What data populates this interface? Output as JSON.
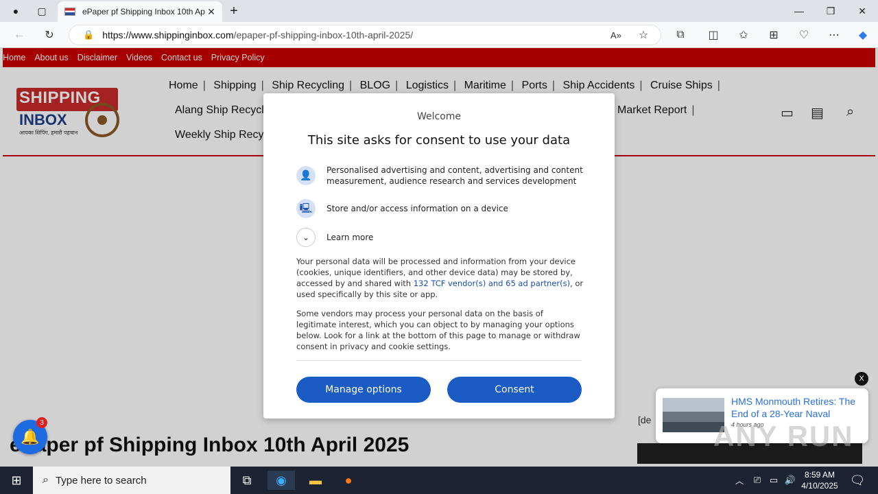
{
  "browser": {
    "tab_title": "ePaper pf Shipping Inbox 10th Ap",
    "url_host": "https://www.shippinginbox.com",
    "url_path": "/epaper-pf-shipping-inbox-10th-april-2025/"
  },
  "site": {
    "top_links": [
      "Home",
      "About us",
      "Disclaimer",
      "Videos",
      "Contact us",
      "Privacy Policy"
    ],
    "logo": {
      "name": "SHIPPING",
      "url_small": "www.shippinginbox.com",
      "inbox": "INBOX",
      "tagline": "आपका शिपिंग, हमारी पहचान"
    },
    "menu_row1": [
      "Home",
      "Shipping",
      "Ship Recycling",
      "BLOG",
      "Logistics",
      "Maritime",
      "Ports",
      "Ship Accidents",
      "Cruise Ships"
    ],
    "menu_row2_left": "Alang Ship Recycli",
    "menu_row2_right": "Market Report",
    "menu_row3_left": "Weekly Ship Recyc",
    "page_title": "ePaper pf Shipping Inbox 10th April 2025",
    "side_text": "[de"
  },
  "consent": {
    "welcome": "Welcome",
    "heading": "This site asks for consent to use your data",
    "purpose1": "Personalised advertising and content, advertising and content measurement, audience research and services development",
    "purpose2": "Store and/or access information on a device",
    "learn_more": "Learn more",
    "para1_a": "Your personal data will be processed and information from your device (cookies, unique identifiers, and other device data) may be stored by, accessed by and shared with ",
    "para1_link": "132 TCF vendor(s) and 65 ad partner(s)",
    "para1_b": ", or used specifically by this site or app.",
    "para2": "Some vendors may process your personal data on the basis of legitimate interest, which you can object to by managing your options below. Look for a link at the bottom of this page to manage or withdraw consent in privacy and cookie settings.",
    "manage_label": "Manage options",
    "consent_label": "Consent"
  },
  "notification": {
    "badge": "3"
  },
  "news_popup": {
    "headline": "HMS Monmouth Retires: The End of a 28-Year Naval",
    "time": "4 hours ago",
    "close": "X"
  },
  "watermark": "ANY RUN",
  "taskbar": {
    "search_placeholder": "Type here to search",
    "time": "8:59 AM",
    "date": "4/10/2025"
  }
}
